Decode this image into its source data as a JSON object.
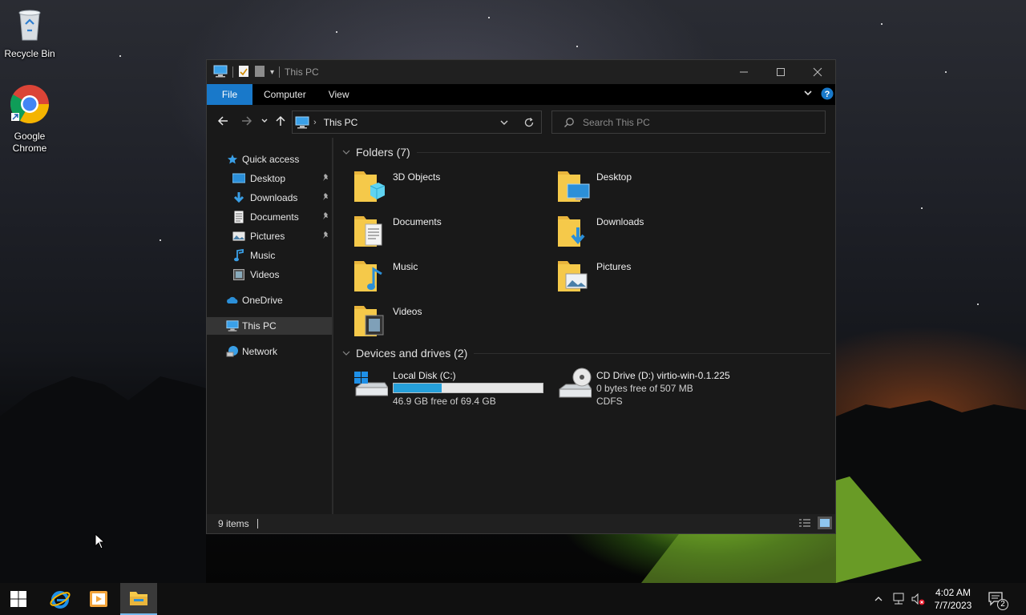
{
  "desktop": {
    "icons": [
      {
        "label": "Recycle Bin",
        "icon": "recycle-bin-icon"
      },
      {
        "label": "Google\nChrome",
        "label_line1": "Google",
        "label_line2": "Chrome",
        "icon": "chrome-icon"
      }
    ]
  },
  "window": {
    "title": "This PC",
    "ribbon": {
      "tabs": [
        "File",
        "Computer",
        "View"
      ],
      "active": "File"
    },
    "address": {
      "path": "This PC"
    },
    "search": {
      "placeholder": "Search This PC"
    },
    "nav": {
      "quick_access": "Quick access",
      "items": [
        {
          "label": "Desktop",
          "pinned": true,
          "icon": "desktop-folder-icon"
        },
        {
          "label": "Downloads",
          "pinned": true,
          "icon": "downloads-arrow-icon"
        },
        {
          "label": "Documents",
          "pinned": true,
          "icon": "documents-icon"
        },
        {
          "label": "Pictures",
          "pinned": true,
          "icon": "pictures-icon"
        },
        {
          "label": "Music",
          "pinned": false,
          "icon": "music-note-icon"
        },
        {
          "label": "Videos",
          "pinned": false,
          "icon": "videos-icon"
        }
      ],
      "onedrive": "OneDrive",
      "this_pc": "This PC",
      "network": "Network"
    },
    "content": {
      "folders_header": "Folders (7)",
      "folders": [
        "3D Objects",
        "Desktop",
        "Documents",
        "Downloads",
        "Music",
        "Pictures",
        "Videos"
      ],
      "devices_header": "Devices and drives (2)",
      "drives": [
        {
          "name": "Local Disk (C:)",
          "free_text": "46.9 GB free of 69.4 GB",
          "used_fraction": 0.324
        },
        {
          "name": "CD Drive (D:) virtio-win-0.1.225",
          "free_text": "0 bytes free of 507 MB",
          "fs": "CDFS"
        }
      ]
    },
    "status": {
      "items": "9 items"
    }
  },
  "taskbar": {
    "time": "4:02 AM",
    "date": "7/7/2023",
    "notifications": "2"
  },
  "colors": {
    "accent": "#1979ca",
    "drive_bar": "#26a0da",
    "folder": "#f5c94a"
  }
}
